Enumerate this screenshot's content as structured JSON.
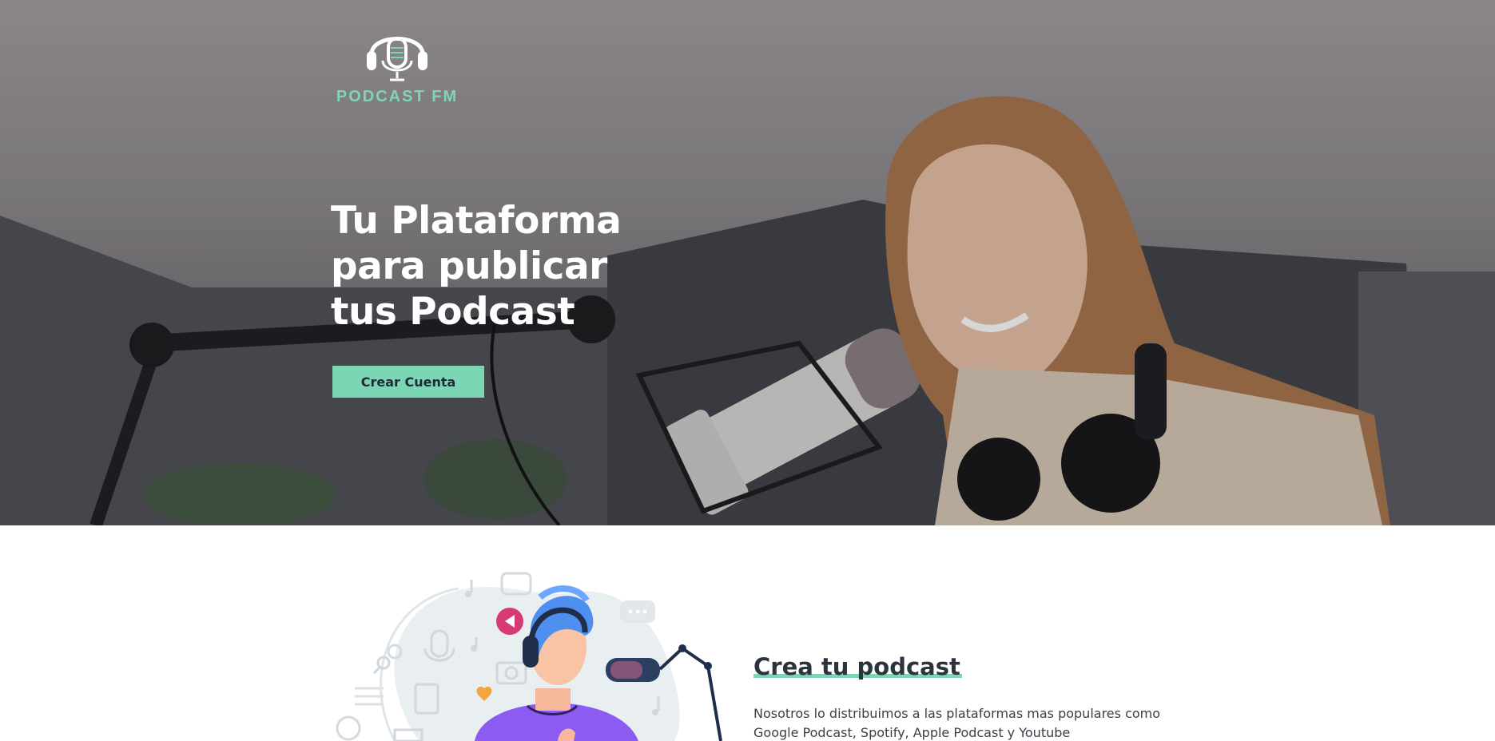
{
  "brand": {
    "name": "PODCAST FM",
    "accent_color": "#7dd6b3",
    "logo_icon": "microphone-headphones-icon"
  },
  "hero": {
    "title_lines": [
      "Tu Plataforma",
      "para publicar",
      "tus Podcast"
    ],
    "cta_label": "Crear Cuenta",
    "image": "woman-podcasting-with-microphone-and-headphones"
  },
  "feature": {
    "title": "Crea tu podcast",
    "description": "Nosotros lo distribuimos a las plataformas mas populares como Google Podcast, Spotify, Apple Podcast y Youtube",
    "illustration": "podcaster-with-headphones-and-microphone-illustration"
  },
  "colors": {
    "heading": "#2b333d",
    "body_text": "#3a3f46",
    "hero_text": "#ffffff"
  }
}
